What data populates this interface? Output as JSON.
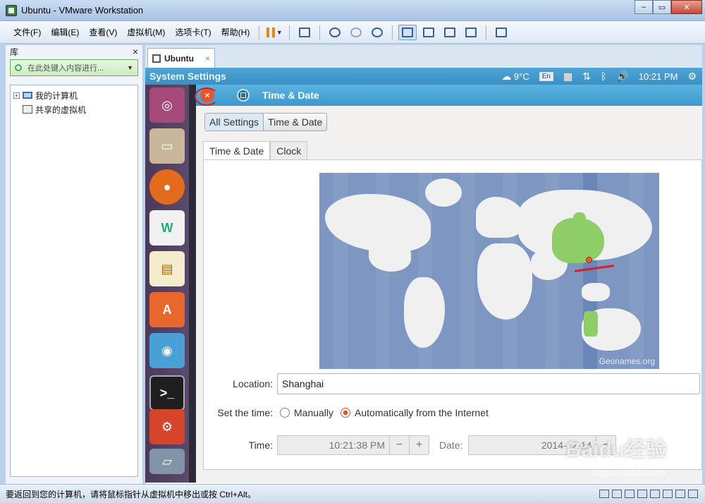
{
  "window": {
    "title": "Ubuntu - VMware Workstation"
  },
  "menubar": {
    "items": [
      "文件(F)",
      "编辑(E)",
      "查看(V)",
      "虚拟机(M)",
      "选项卡(T)",
      "帮助(H)"
    ]
  },
  "library": {
    "title": "库",
    "close": "×",
    "search_placeholder": "在此处键入内容进行...",
    "tree": [
      "我的计算机",
      "共享的虚拟机"
    ]
  },
  "tab": {
    "label": "Ubuntu",
    "close": "×"
  },
  "ubuntu_panel": {
    "title": "System Settings",
    "temperature": "9°C",
    "keyboard": "En",
    "clock": "10:21 PM"
  },
  "settings_window": {
    "title": "Time & Date",
    "close_glyph": "×",
    "breadcrumbs": [
      "All Settings",
      "Time & Date"
    ],
    "tabs": [
      "Time & Date",
      "Clock"
    ],
    "map_credit": "Geonames.org",
    "location_label": "Location:",
    "location_value": "Shanghai",
    "set_time_label": "Set the time:",
    "set_time_options": [
      "Manually",
      "Automatically from the Internet"
    ],
    "selected_option": "Automatically from the Internet",
    "time_label": "Time:",
    "time_value": "10:21:38 PM",
    "minus": "−",
    "plus": "+",
    "date_label": "Date:",
    "date_value": "2014-12-14"
  },
  "statusbar": {
    "message": "要返回到您的计算机，请将鼠标指针从虚拟机中移出或按 Ctrl+Alt。"
  },
  "watermark": {
    "brand": "Baidu经验",
    "url": "jingyan.baidu.com"
  },
  "colors": {
    "ubuntu_panel": "#3a8fc4",
    "close_button": "#e8562e",
    "china_highlight": "#8fcd68",
    "map_ocean": "#7e97c2"
  }
}
